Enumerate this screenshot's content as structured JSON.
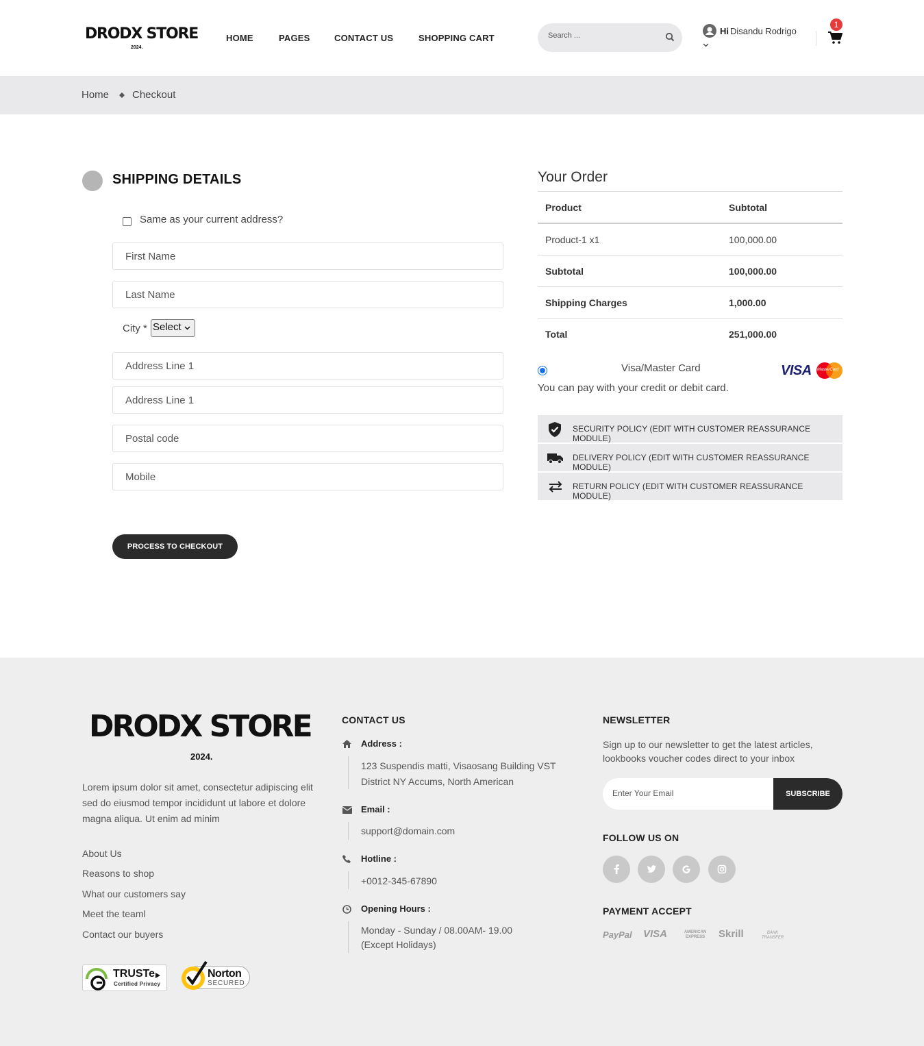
{
  "header": {
    "logo": "DRODX STORE",
    "logo_year": "2024.",
    "nav": [
      "HOME",
      "PAGES",
      "CONTACT US",
      "SHOPPING CART"
    ],
    "search_placeholder": "Search ...",
    "user_greeting": "Hi",
    "user_name": "Disandu Rodrigo",
    "cart_count": "1"
  },
  "breadcrumb": {
    "home": "Home",
    "current": "Checkout"
  },
  "shipping": {
    "title": "SHIPPING DETAILS",
    "same_address_label": "Same as your current address?",
    "first_name": "First Name",
    "last_name": "Last Name",
    "city_label": "City *",
    "city_select": "Select",
    "address1": "Address Line 1",
    "address2": "Address Line 1",
    "postal": "Postal code",
    "mobile": "Mobile",
    "button": "PROCESS TO CHECKOUT"
  },
  "order": {
    "title": "Your Order",
    "col_product": "Product",
    "col_subtotal": "Subtotal",
    "rows": [
      {
        "label": "Product-1 x1",
        "value": "100,000.00"
      },
      {
        "label": "Subtotal",
        "value": "100,000.00"
      },
      {
        "label": "Shipping Charges",
        "value": "1,000.00"
      },
      {
        "label": "Total",
        "value": "251,000.00"
      }
    ],
    "payment_method": "Visa/Master Card",
    "payment_note": "You can pay with your credit or debit card.",
    "visa": "VISA",
    "mastercard": "MasterCard",
    "policies": [
      "SECURITY POLICY (EDIT WITH CUSTOMER REASSURANCE MODULE)",
      "DELIVERY POLICY (EDIT WITH CUSTOMER REASSURANCE MODULE)",
      "RETURN POLICY (EDIT WITH CUSTOMER REASSURANCE MODULE)"
    ]
  },
  "footer": {
    "logo": "DRODX STORE",
    "logo_year": "2024.",
    "description": "Lorem ipsum dolor sit amet, consectetur adipiscing elit sed do eiusmod tempor incididunt ut labore et dolore magna aliqua. Ut enim ad minim",
    "links": [
      "About Us",
      "Reasons to shop",
      "What our customers say",
      "Meet the teaml",
      "Contact our buyers"
    ],
    "truste": "TRUSTe",
    "truste_sub": "Certified Privacy",
    "norton": "Norton",
    "norton_sub": "SECURED",
    "contact_title": "CONTACT US",
    "address_label": "Address :",
    "address_1": "123 Suspendis matti, Visaosang Building VST",
    "address_2": "District NY Accums, North American",
    "email_label": "Email :",
    "email": "support@domain.com",
    "hotline_label": "Hotline :",
    "hotline": "+0012-345-67890",
    "hours_label": "Opening Hours :",
    "hours_1": "Monday - Sunday / 08.00AM- 19.00",
    "hours_2": "(Except Holidays)",
    "newsletter_title": "NEWSLETTER",
    "newsletter_text": "Sign up to our newsletter to get the latest articles, lookbooks voucher codes direct to your inbox",
    "email_placeholder": "Enter Your Email",
    "subscribe": "SUBSCRIBE",
    "follow_title": "FOLLOW US ON",
    "payment_title": "PAYMENT ACCEPT",
    "payment_logos": [
      "PayPal",
      "VISA",
      "AMERICAN EXPRESS",
      "Skrill",
      "BANK TRANSFER"
    ]
  }
}
